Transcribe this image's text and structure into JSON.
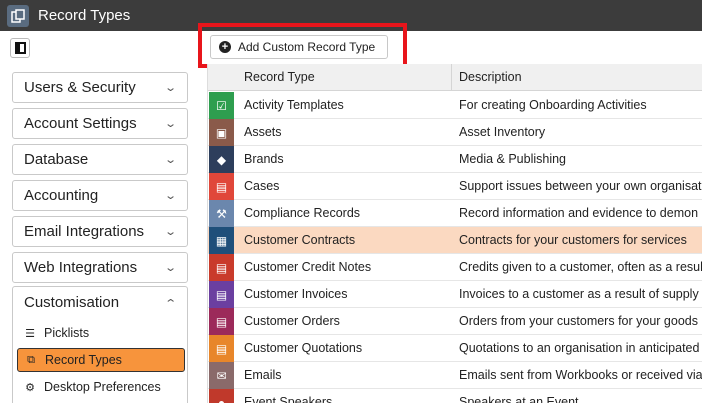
{
  "window": {
    "title": "Record Types",
    "icon": "record-types-icon"
  },
  "toolbar": {
    "add_label": "Add Custom Record Type",
    "add_icon": "plus-circle-icon",
    "highlight_color": "#e8151b"
  },
  "sidebar": {
    "sections": [
      {
        "label": "Users & Security"
      },
      {
        "label": "Account Settings"
      },
      {
        "label": "Database"
      },
      {
        "label": "Accounting"
      },
      {
        "label": "Email Integrations"
      },
      {
        "label": "Web Integrations"
      }
    ],
    "customisation": {
      "label": "Customisation",
      "items": [
        {
          "label": "Picklists",
          "icon": "list-icon"
        },
        {
          "label": "Record Types",
          "icon": "record-types-icon",
          "active": true
        },
        {
          "label": "Desktop Preferences",
          "icon": "sliders-icon"
        }
      ]
    },
    "active_color": "#f7943c"
  },
  "grid": {
    "columns": [
      "Record Type",
      "Description"
    ],
    "selected_color": "#fbd9c1",
    "rows": [
      {
        "type": "Activity Templates",
        "desc": "For creating Onboarding Activities",
        "color": "#2e9e4f",
        "icon": "clipboard-icon"
      },
      {
        "type": "Assets",
        "desc": "Asset Inventory",
        "color": "#8a5a4a",
        "icon": "cube-icon"
      },
      {
        "type": "Brands",
        "desc": "Media & Publishing",
        "color": "#2d3e5c",
        "icon": "diamond-icon"
      },
      {
        "type": "Cases",
        "desc": "Support issues between your own organisat",
        "color": "#e0473a",
        "icon": "briefcase-icon"
      },
      {
        "type": "Compliance Records",
        "desc": "Record information and evidence to demon",
        "color": "#6b87ad",
        "icon": "gavel-icon"
      },
      {
        "type": "Customer Contracts",
        "desc": "Contracts for your customers for services",
        "color": "#1f4f7a",
        "icon": "contract-icon",
        "selected": true
      },
      {
        "type": "Customer Credit Notes",
        "desc": "Credits given to a customer, often as a resul",
        "color": "#c93b2b",
        "icon": "credit-note-icon"
      },
      {
        "type": "Customer Invoices",
        "desc": "Invoices to a customer as a result of supply",
        "color": "#6b3fa0",
        "icon": "invoice-icon"
      },
      {
        "type": "Customer Orders",
        "desc": "Orders from your customers for your goods",
        "color": "#9c2a5a",
        "icon": "order-icon"
      },
      {
        "type": "Customer Quotations",
        "desc": "Quotations to an organisation in anticipated",
        "color": "#e8862a",
        "icon": "quotation-icon"
      },
      {
        "type": "Emails",
        "desc": "Emails sent from Workbooks or received via",
        "color": "#8a6a6a",
        "icon": "envelope-icon"
      },
      {
        "type": "Event Speakers",
        "desc": "Speakers at an Event",
        "color": "#c0392b",
        "icon": "speaker-icon"
      }
    ]
  }
}
